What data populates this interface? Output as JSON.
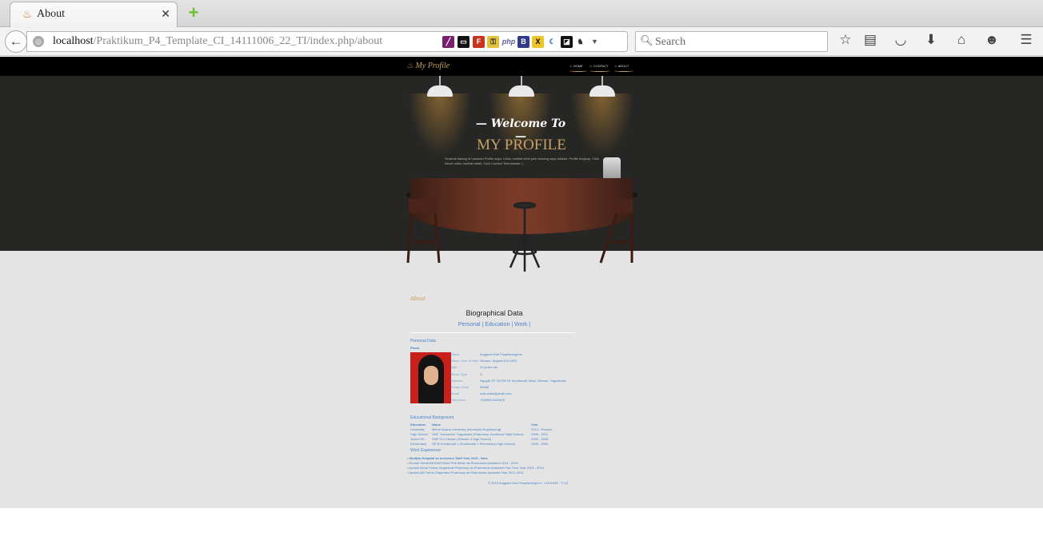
{
  "browser": {
    "tab_title": "About",
    "url_host": "localhost",
    "url_path": "/Praktikum_P4_Template_CI_14111006_22_TI/index.php/about",
    "search_placeholder": "Search"
  },
  "site": {
    "brand": "My Profile",
    "menu": [
      "HOME",
      "CONTACT",
      "ABOUT"
    ],
    "welcome": "Welcome To",
    "title": "MY PROFILE",
    "tagline": "Selamat datang di halaman Profile saya. Untuk melihat lebih jauh tentang saya silakan. Profile lengkap. Click About untuk melihat detail. Click Contact Terimakasih :)"
  },
  "about": {
    "heading": "About",
    "bio_title": "Biographical Data",
    "links": [
      "Personal",
      "Education",
      "Work"
    ],
    "personal_title": "Personal Data",
    "photo_label": "Photo",
    "fields": [
      {
        "k": "Name",
        "v": "Anggiani Dah Puspitaningrum"
      },
      {
        "k": "Place, Date of Birth",
        "v": "Sleman, August 2nd 1993"
      },
      {
        "k": "Age",
        "v": "23 years old"
      },
      {
        "k": "Blood Type",
        "v": "O"
      },
      {
        "k": "Address",
        "v": "Ngaglik RT 05 RW 04 Sumberadi, Mlati, Sleman, Yogyakarta"
      },
      {
        "k": "Postal Code",
        "v": "55288"
      },
      {
        "k": "Email",
        "v": "mail.anda@gmail.com"
      },
      {
        "k": "Telephone",
        "v": "+6289612345678"
      }
    ],
    "edu_title": "Educational Background",
    "edu_headers": [
      "Education",
      "Name",
      "Year"
    ],
    "edu_rows": [
      [
        "University",
        "Mercu Buana University (Informatic Engineering)",
        "2014 - Present"
      ],
      [
        "High School",
        "SMF \"Indonesia\" Yogyakarta (Pharmacy Vocational High School)",
        "2008 - 2011"
      ],
      [
        "Junior HS",
        "SMP N 4 Sleman (Sleman 4 High School)",
        "2005 - 2008"
      ],
      [
        "Elementary",
        "SD N Sumberadi 1 (Sumberadi 1 Elementary High School)",
        "1999 - 2005"
      ]
    ],
    "work_title": "Work Experience",
    "work_items": [
      "Sardjito Hospital as Inventory Staff Year 2015 - Now",
      "Rumah Sehat BAZNAS Bina Prof Kilinik as Pharmacist Assistant 2011 - 2012",
      "Apotek Kimia Farma Dirgantara Pharmacy as Pharmacist Assistant Part Time Year 2013 - 2014",
      "Apotek Alfi Farma Dirgantara Pharmacy as Pharmacist Assistant Year 2011-2012"
    ],
    "footer": "© 2016 Anggiani Dah Puspitaningrum - 14111006 - TI 22"
  }
}
